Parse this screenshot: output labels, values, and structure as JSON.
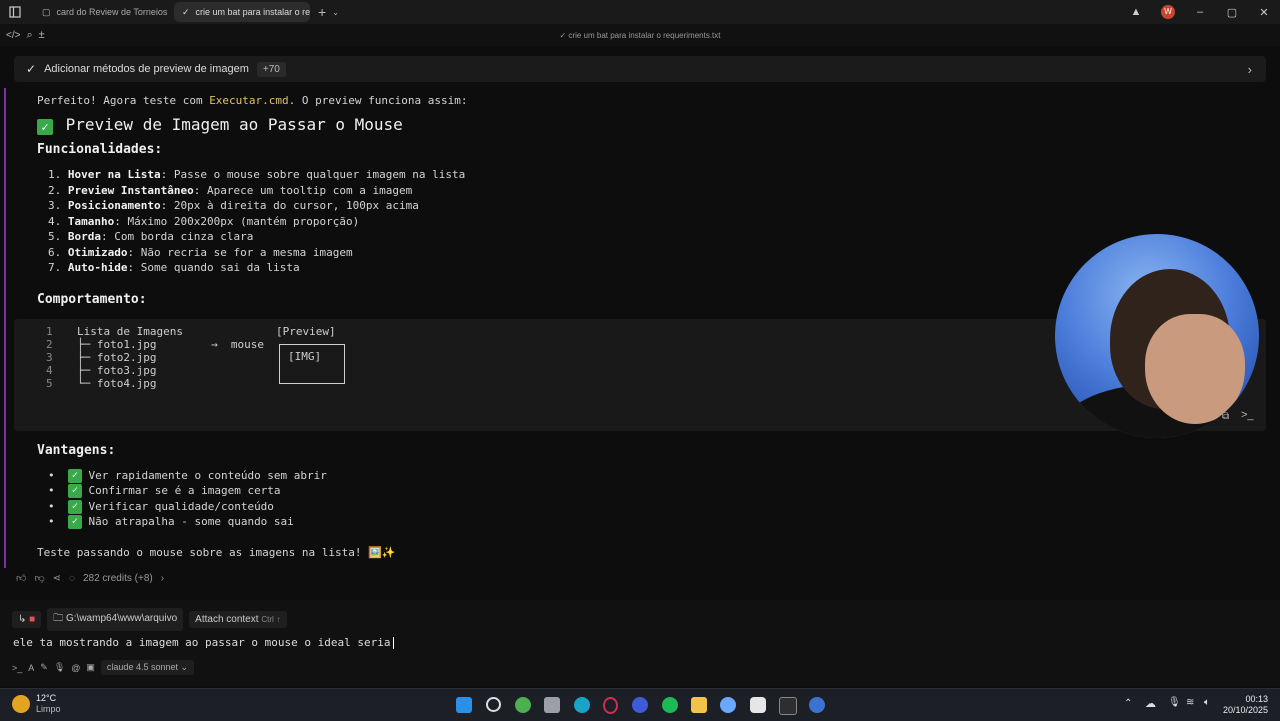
{
  "titlebar": {
    "tabs": [
      {
        "label": "card do Review de Torneios",
        "active": false
      },
      {
        "label": "crie um bat para instalar o req",
        "active": true
      }
    ],
    "new_tab": "+",
    "user_initial": "W"
  },
  "toolbar": {
    "title": "crie um bat para instalar o requeriments.txt"
  },
  "banner": {
    "label": "Adicionar métodos de preview de imagem",
    "count": "+70"
  },
  "content": {
    "intro_prefix": "Perfeito! Agora teste com ",
    "intro_file": "Executar.cmd",
    "intro_suffix": ". O preview funciona assim:",
    "heading": "Preview de Imagem ao Passar o Mouse",
    "features_title": "Funcionalidades:",
    "features": [
      {
        "n": "1.",
        "bold": "Hover na Lista",
        "text": ": Passe o mouse sobre qualquer imagem na lista"
      },
      {
        "n": "2.",
        "bold": "Preview Instantâneo",
        "text": ": Aparece um tooltip com a imagem"
      },
      {
        "n": "3.",
        "bold": "Posicionamento",
        "text": ": 20px à direita do cursor, 100px acima"
      },
      {
        "n": "4.",
        "bold": "Tamanho",
        "text": ": Máximo 200x200px (mantém proporção)"
      },
      {
        "n": "5.",
        "bold": "Borda",
        "text": ": Com borda cinza clara"
      },
      {
        "n": "6.",
        "bold": "Otimizado",
        "text": ": Não recria se for a mesma imagem"
      },
      {
        "n": "7.",
        "bold": "Auto-hide",
        "text": ": Some quando sai da lista"
      }
    ],
    "behavior_title": "Comportamento:",
    "code": {
      "line_numbers": [
        "1",
        "2",
        "3",
        "4",
        "5"
      ],
      "lines": [
        "Lista de Imagens",
        "├─ foto1.jpg",
        "├─ foto2.jpg",
        "├─ foto3.jpg",
        "└─ foto4.jpg"
      ],
      "preview_label": "[Preview]",
      "arrow": "→  mouse",
      "img_label": "[IMG]"
    },
    "advantages_title": "Vantagens:",
    "advantages": [
      "Ver rapidamente o conteúdo sem abrir",
      "Confirmar se é a imagem certa",
      "Verificar qualidade/conteúdo",
      "Não atrapalha - some quando sai"
    ],
    "closing": "Teste passando o mouse sobre as imagens na lista! 🖼️✨"
  },
  "actions": {
    "credits": "282 credits (+8)"
  },
  "input": {
    "path": "G:\\wamp64\\www\\arquivo",
    "attach_label": "Attach context",
    "attach_shortcut": "Ctrl",
    "prompt": "ele ta mostrando a imagem ao passar o mouse o ideal seria",
    "model": "claude 4.5 sonnet"
  },
  "taskbar": {
    "temp": "12°C",
    "condition": "Limpo",
    "time": "00:13",
    "date": "20/10/2025"
  },
  "colors": {
    "accent_purple": "#7e2fa8",
    "check_green": "#3aa94a",
    "highlight": "#dfc26a"
  }
}
